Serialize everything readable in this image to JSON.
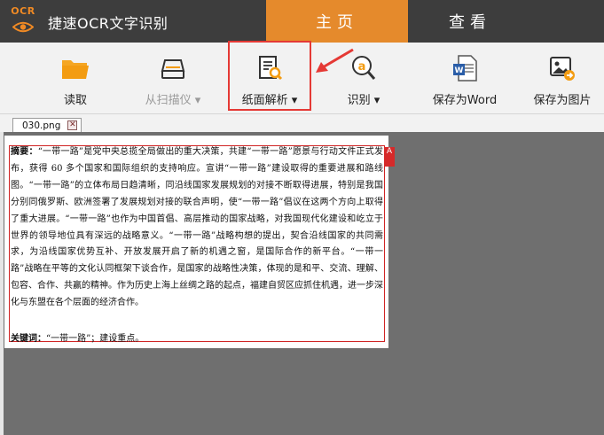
{
  "app": {
    "logo_text": "OCR",
    "title": "捷速OCR文字识别"
  },
  "top_tabs": [
    {
      "label": "主页",
      "active": true
    },
    {
      "label": "查看",
      "active": false
    }
  ],
  "toolbar": {
    "items": [
      {
        "label": "读取",
        "icon": "folder-icon",
        "dropdown": false,
        "enabled": true
      },
      {
        "label": "从扫描仪 ▾",
        "icon": "scanner-icon",
        "dropdown": true,
        "enabled": false
      },
      {
        "label": "纸面解析 ▾",
        "icon": "page-analysis-icon",
        "dropdown": true,
        "enabled": true,
        "highlighted": true
      },
      {
        "label": "识别 ▾",
        "icon": "recognize-icon",
        "dropdown": true,
        "enabled": true
      },
      {
        "label": "保存为Word",
        "icon": "word-icon",
        "dropdown": false,
        "enabled": true
      },
      {
        "label": "保存为图片",
        "icon": "image-icon",
        "dropdown": false,
        "enabled": true
      }
    ]
  },
  "document_tab": {
    "filename": "030.png",
    "close_glyph": "✕"
  },
  "page": {
    "ocr_badge": "A",
    "abstract_label": "摘要：",
    "abstract_text": "“一带一路”是党中央总揽全局做出的重大决策，共建“一带一路”愿景与行动文件正式发布，获得 60 多个国家和国际组织的支持响应。宣讲“一带一路”建设取得的重要进展和路线图。“一带一路”的立体布局日趋清晰，同沿线国家发展规划的对接不断取得进展，特别是我国分别同俄罗斯、欧洲签署了发展规划对接的联合声明，使“一带一路”倡议在这两个方向上取得了重大进展。“一带一路”也作为中国首倡、高层推动的国家战略，对我国现代化建设和屹立于世界的领导地位具有深远的战略意义。“一带一路”战略构想的提出，契合沿线国家的共同需求，为沿线国家优势互补、开放发展开启了新的机遇之窗，是国际合作的新平台。“一带一路”战略在平等的文化认同框架下谈合作，是国家的战略性决策，体现的是和平、交流、理解、包容、合作、共赢的精神。作为历史上海上丝绸之路的起点，福建自贸区应抓住机遇，进一步深化与东盟在各个层面的经济合作。",
    "keywords_label": "关键词：",
    "keywords_text": "“一带一路”；建设重点。"
  },
  "colors": {
    "topbar": "#3d3d3d",
    "accent_orange": "#e58a2c",
    "highlight_red": "#e53935",
    "workspace": "#6f6f6f"
  }
}
